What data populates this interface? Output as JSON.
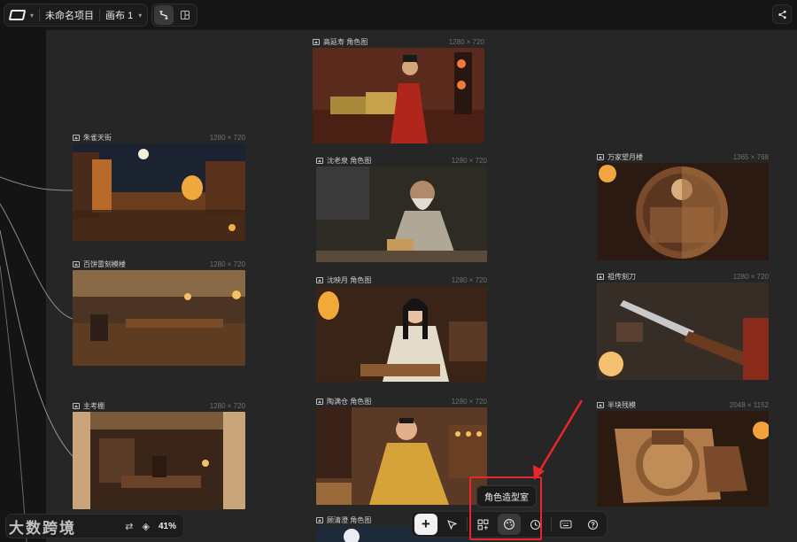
{
  "project": {
    "name": "未命名项目",
    "canvas": "画布 1"
  },
  "icons": {
    "logo": "logo-icon",
    "link_mode": "link-icon",
    "layout_mode": "layout-icon",
    "share": "share-icon",
    "add": "plus-icon",
    "select": "cursor-icon",
    "components": "grid-icon",
    "character_studio": "palette-icon",
    "history": "clock-icon",
    "keyboard": "keyboard-icon",
    "help": "help-icon"
  },
  "cards": [
    {
      "title": "朱雀天街",
      "size": "1280 × 720"
    },
    {
      "title": "百饼雷刻模楼",
      "size": "1280 × 720"
    },
    {
      "title": "主考棚",
      "size": "1280 × 720"
    },
    {
      "title": "高延寿 角色图",
      "size": "1280 × 720"
    },
    {
      "title": "沈老泉 角色图",
      "size": "1280 × 720"
    },
    {
      "title": "沈映月 角色图",
      "size": "1280 × 720"
    },
    {
      "title": "陶满仓 角色图",
      "size": "1280 × 720"
    },
    {
      "title": "顾清澄 角色图",
      "size": ""
    },
    {
      "title": "万家望月楼",
      "size": "1365 × 768"
    },
    {
      "title": "祖传刻刀",
      "size": "1280 × 720"
    },
    {
      "title": "半块残模",
      "size": "2048 × 1152"
    }
  ],
  "zoom": {
    "value": "41%"
  },
  "tooltip": {
    "text": "角色造型室"
  },
  "watermark": {
    "text": "大数跨境"
  },
  "colors": {
    "highlight": "#e8262c",
    "canvas": "#262626"
  }
}
